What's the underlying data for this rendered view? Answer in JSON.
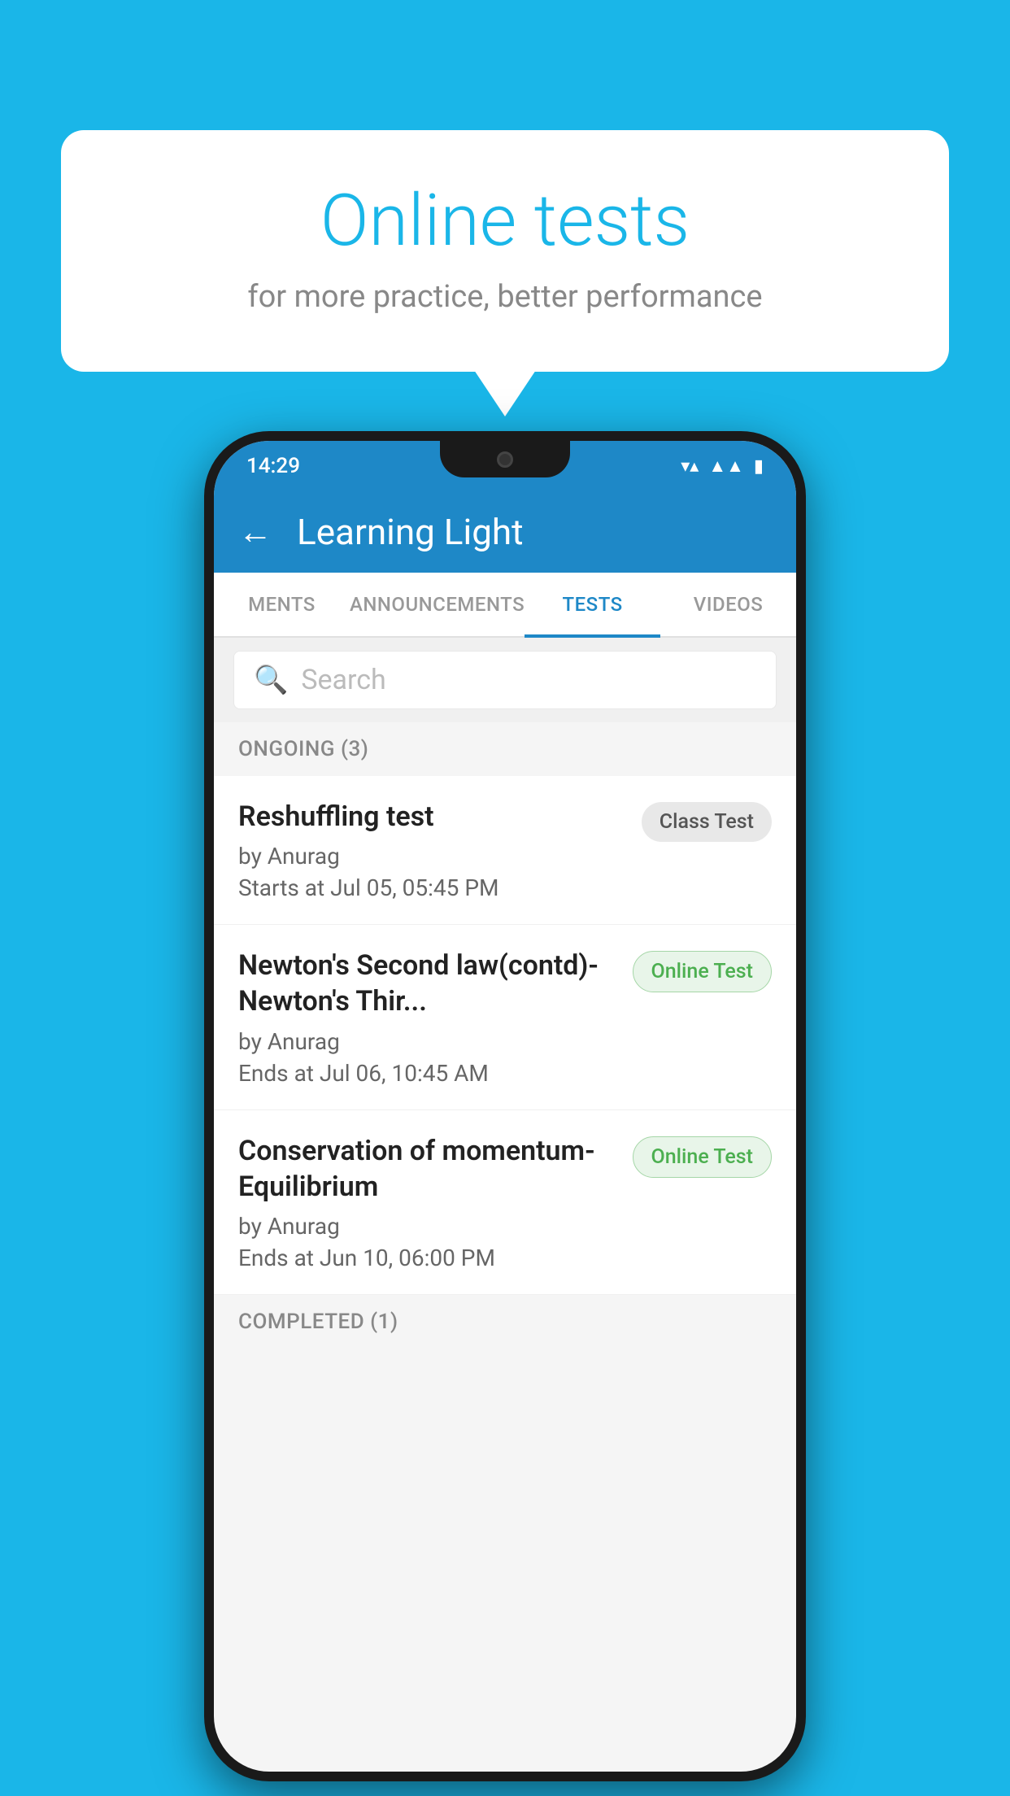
{
  "background": {
    "color": "#1ab6e8"
  },
  "speech_bubble": {
    "title": "Online tests",
    "subtitle": "for more practice, better performance"
  },
  "phone": {
    "status_bar": {
      "time": "14:29",
      "icons": [
        "wifi",
        "signal",
        "battery"
      ]
    },
    "app_bar": {
      "back_label": "←",
      "title": "Learning Light"
    },
    "tabs": [
      {
        "label": "MENTS",
        "active": false
      },
      {
        "label": "ANNOUNCEMENTS",
        "active": false
      },
      {
        "label": "TESTS",
        "active": true
      },
      {
        "label": "VIDEOS",
        "active": false
      }
    ],
    "search": {
      "placeholder": "Search"
    },
    "ongoing_section": {
      "label": "ONGOING (3)"
    },
    "test_items": [
      {
        "title": "Reshuffling test",
        "author": "by Anurag",
        "time": "Starts at  Jul 05, 05:45 PM",
        "badge": "Class Test",
        "badge_type": "class"
      },
      {
        "title": "Newton's Second law(contd)-Newton's Thir...",
        "author": "by Anurag",
        "time": "Ends at  Jul 06, 10:45 AM",
        "badge": "Online Test",
        "badge_type": "online"
      },
      {
        "title": "Conservation of momentum-Equilibrium",
        "author": "by Anurag",
        "time": "Ends at  Jun 10, 06:00 PM",
        "badge": "Online Test",
        "badge_type": "online"
      }
    ],
    "completed_section": {
      "label": "COMPLETED (1)"
    }
  }
}
